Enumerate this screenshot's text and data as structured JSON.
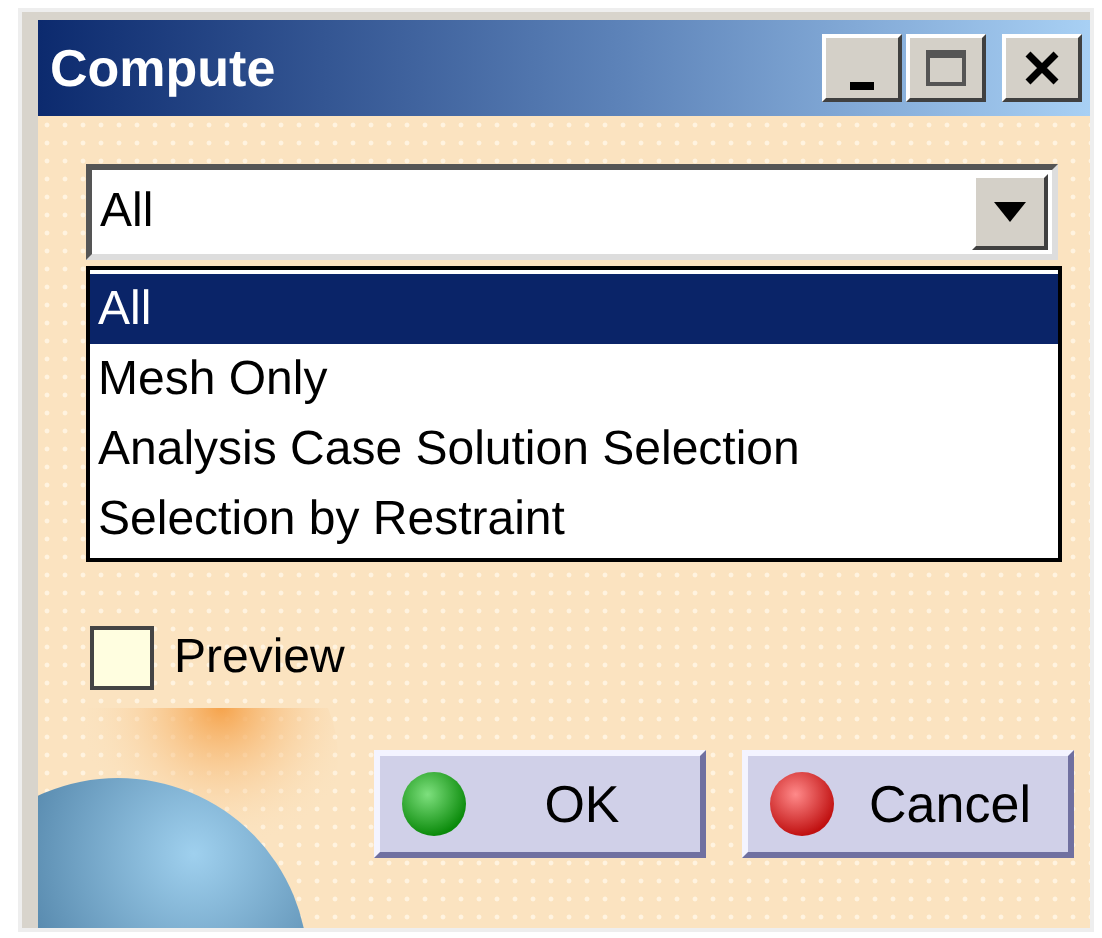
{
  "window": {
    "title": "Compute"
  },
  "dropdown": {
    "value": "All",
    "expanded": true,
    "options": [
      {
        "label": "All",
        "selected": true
      },
      {
        "label": "Mesh Only",
        "selected": false
      },
      {
        "label": "Analysis Case Solution Selection",
        "selected": false
      },
      {
        "label": "Selection by Restraint",
        "selected": false
      }
    ]
  },
  "preview": {
    "label": "Preview",
    "checked": false
  },
  "buttons": [
    {
      "kind": "ok",
      "label": "OK"
    },
    {
      "kind": "cancel",
      "label": "Cancel"
    }
  ]
}
